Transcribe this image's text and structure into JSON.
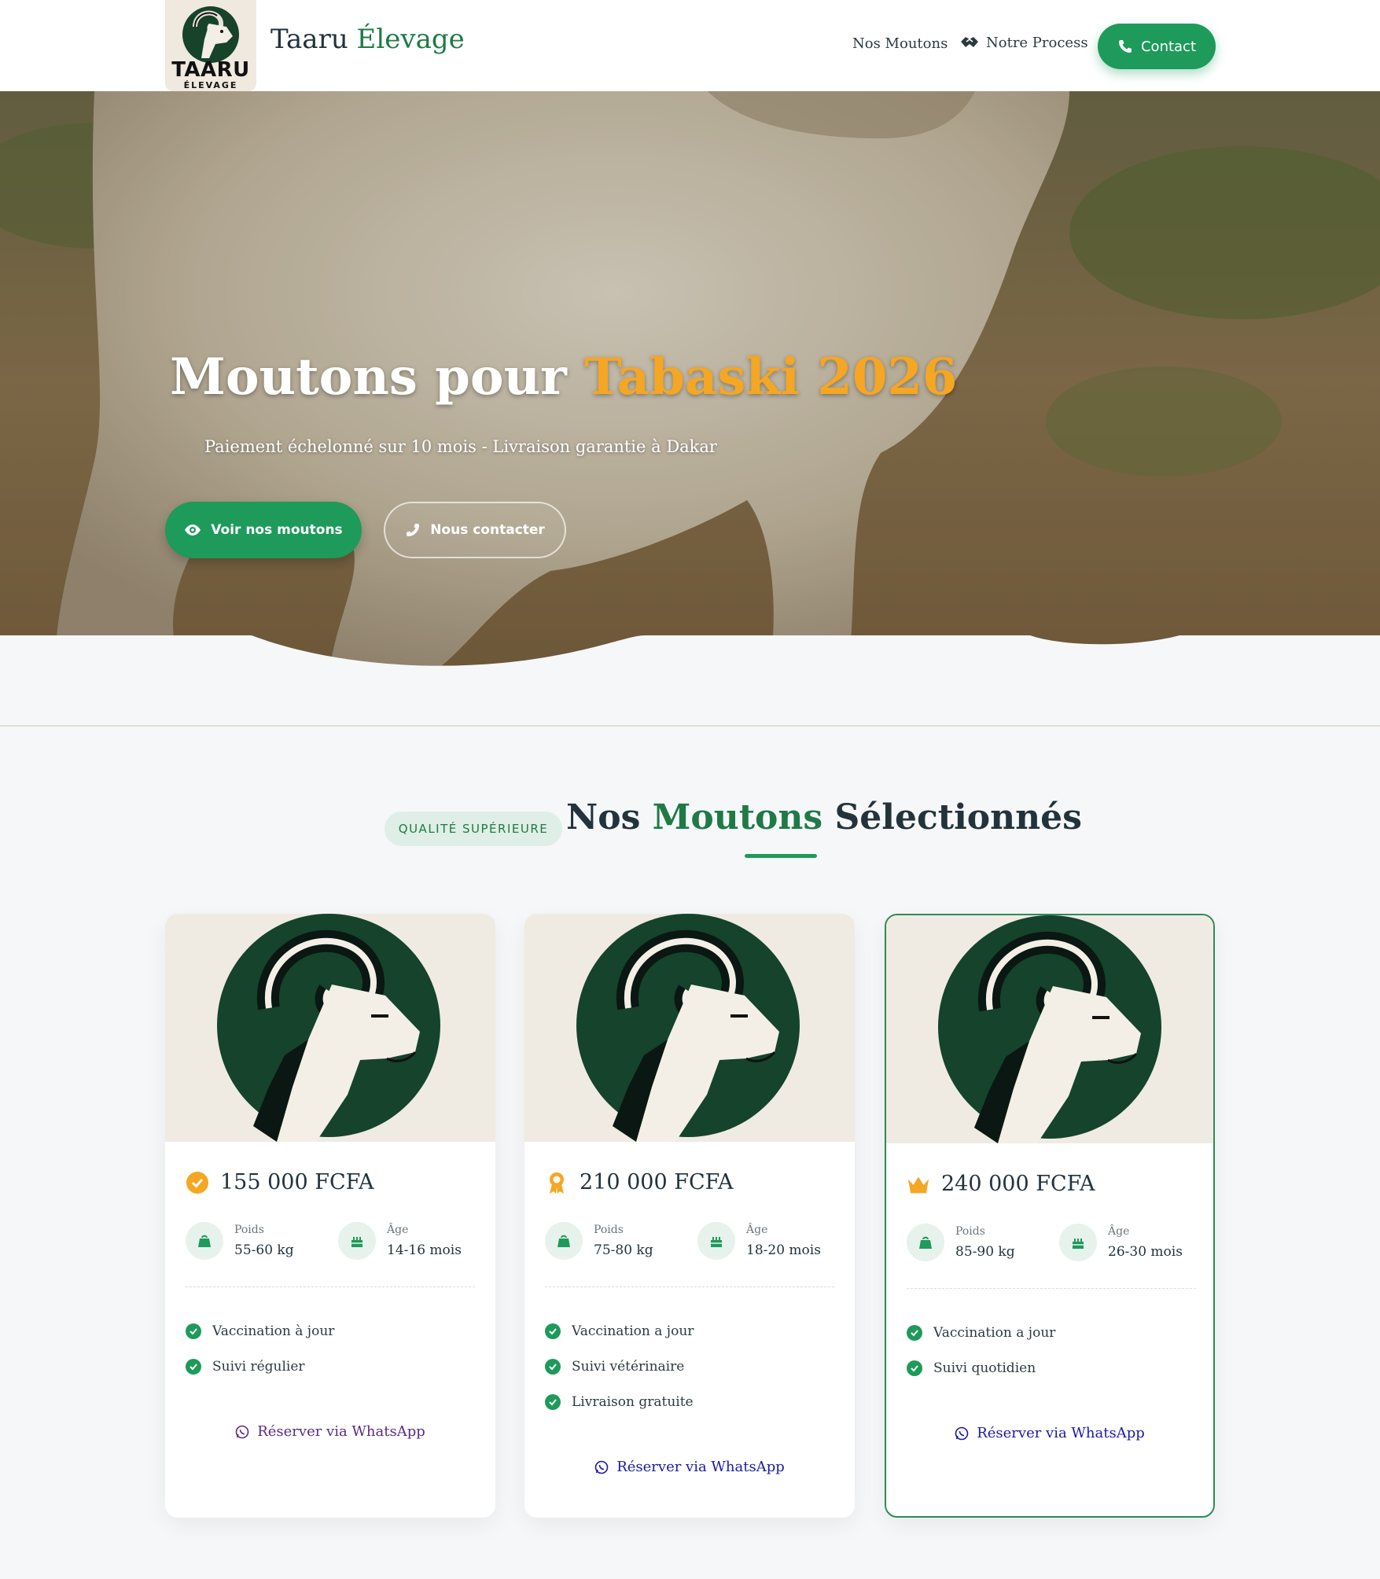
{
  "nav": {
    "logo_word": "TAARU",
    "logo_sub": "ÉLEVAGE",
    "brand_main": "Taaru",
    "brand_accent": "Élevage",
    "links": [
      "Nos Moutons",
      "Notre Process"
    ],
    "contact_label": "Contact"
  },
  "hero": {
    "title_main": "Moutons pour",
    "title_accent": "Tabaski 2026",
    "subtitle": "Paiement échelonné sur 10 mois - Livraison garantie à Dakar",
    "primary_button": "Voir nos moutons",
    "secondary_button": "Nous contacter"
  },
  "section": {
    "badge": "QUALITÉ SUPÉRIEURE",
    "title_part1": "Nos",
    "title_accent": "Moutons",
    "title_part2": "Sélectionnés"
  },
  "cards": [
    {
      "price": "155 000 FCFA",
      "price_icon": "check-badge-icon",
      "weight_label": "Poids",
      "weight": "55-60 kg",
      "age_label": "Âge",
      "age": "14-16 mois",
      "features": [
        "Vaccination à jour",
        "Suivi régulier"
      ],
      "cta": "Réserver via WhatsApp",
      "cta_color": "#5b2a86"
    },
    {
      "price": "210 000 FCFA",
      "price_icon": "award-ribbon-icon",
      "weight_label": "Poids",
      "weight": "75-80 kg",
      "age_label": "Âge",
      "age": "18-20 mois",
      "features": [
        "Vaccination a jour",
        "Suivi vétérinaire",
        "Livraison gratuite"
      ],
      "cta": "Réserver via WhatsApp",
      "cta_color": "#1a1aa6"
    },
    {
      "price": "240 000 FCFA",
      "price_icon": "crown-icon",
      "weight_label": "Poids",
      "weight": "85-90 kg",
      "age_label": "Âge",
      "age": "26-30 mois",
      "features": [
        "Vaccination a jour",
        "Suivi quotidien"
      ],
      "cta": "Réserver via WhatsApp",
      "cta_color": "#1a1aa6"
    }
  ],
  "colors": {
    "brand_green": "#1e9a5b",
    "accent_orange": "#f5a623",
    "dark_text": "#22333b"
  }
}
